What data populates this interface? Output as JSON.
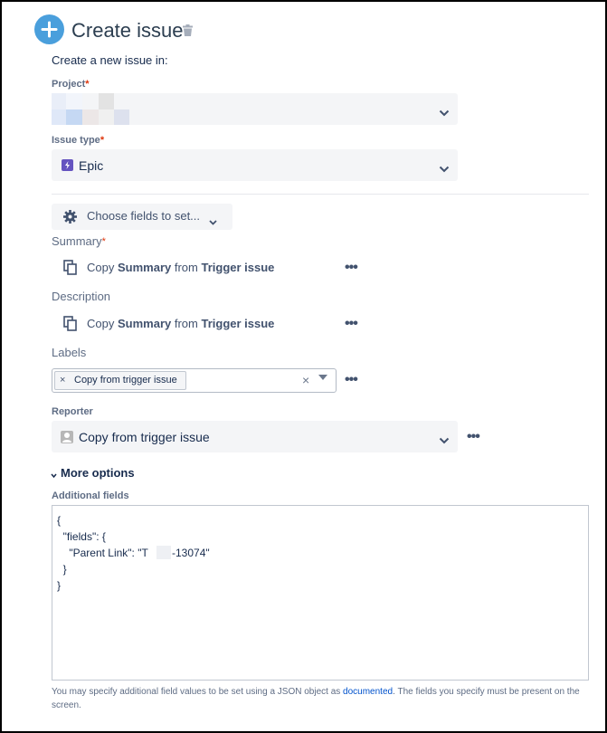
{
  "header": {
    "title": "Create issue",
    "icons": [
      "plus-circle-icon",
      "trash-icon"
    ]
  },
  "intro": "Create a new issue in:",
  "project": {
    "label": "Project",
    "required_mark": "*"
  },
  "issue_type": {
    "label": "Issue type",
    "required_mark": "*",
    "value": "Epic",
    "icon": "epic-icon"
  },
  "choose_fields": {
    "label": "Choose fields to set...",
    "icon": "gear-icon"
  },
  "summary": {
    "label": "Summary",
    "required_mark": "*",
    "copy": "Copy",
    "field": "Summary",
    "from": "from",
    "source": "Trigger issue"
  },
  "description": {
    "label": "Description",
    "copy": "Copy",
    "field": "Summary",
    "from": "from",
    "source": "Trigger issue"
  },
  "labels": {
    "label": "Labels",
    "tag": "Copy from trigger issue",
    "tag_remove": "×",
    "clear": "×"
  },
  "reporter": {
    "label": "Reporter",
    "value": "Copy from trigger issue"
  },
  "more_options": {
    "label": "More options"
  },
  "additional_fields": {
    "label": "Additional fields",
    "json_lines": [
      "{",
      "  \"fields\": {",
      "    \"Parent Link\": \"T",
      "-13074\"",
      "  }",
      "}"
    ]
  },
  "help": {
    "before": "You may specify additional field values to be set using a JSON object as ",
    "link": "documented",
    "after": ". The fields you specify must be present on the screen."
  },
  "more_menu": "•••",
  "colors": {
    "accent": "#4a9fdc",
    "required": "#de350b",
    "epic": "#6554c0",
    "link": "#0052cc"
  }
}
